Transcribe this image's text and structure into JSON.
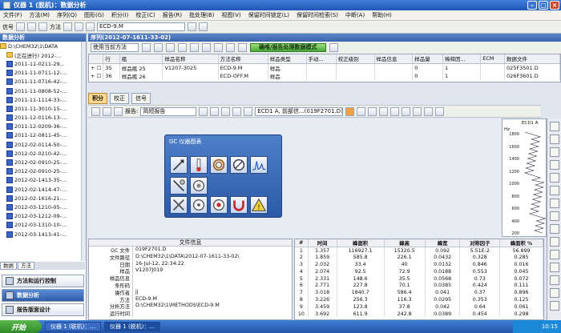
{
  "window": {
    "title": "仪器 1 (脱机)：数据分析"
  },
  "menu": {
    "items": [
      "文件(F)",
      "方法(M)",
      "序列(Q)",
      "图形(G)",
      "积分(I)",
      "校正(C)",
      "报告(R)",
      "批处理(B)",
      "视图(V)",
      "保留时间锁定(L)",
      "保留时间检索(S)",
      "中断(A)",
      "帮助(H)"
    ]
  },
  "toolbar": {
    "signal_label": "信号",
    "method_label": "方法",
    "method_value": "ECD-9.M"
  },
  "left_panel": {
    "title": "数据分析",
    "root": "D:\\CHEM32\\1\\DATA",
    "items": [
      "(正在进行) 2012-...",
      "2011-11-0211-29...",
      "2011-11-0711-12-...",
      "2011-11-0716-42-...",
      "2011-11-0808-52-...",
      "2011-11-1114-33-...",
      "2011-11-3010-15-...",
      "2011-12-0116-13-...",
      "2011-12-0209-36-...",
      "2011-12-0811-45-...",
      "2012-02-0114-50-...",
      "2012-02-0210-42-...",
      "2012-02-0910-25-...",
      "2012-02-0910-25-...",
      "2012-02-1413-35-...",
      "2012-02-1414-47-...",
      "2012-02-1616-21-...",
      "2012-03-1210-05-...",
      "2012-03-1212-09-...",
      "2012-03-1310-10-...",
      "2012-03-1413-41-..."
    ],
    "tabs": [
      "数据",
      "方法"
    ],
    "nav": [
      "方法和运行控制",
      "数据分析",
      "报告版面设计"
    ]
  },
  "sequence": {
    "title": "序列(2012-07-1611-33-02)",
    "method_select": "使用当前方法",
    "status_button": "确唯/报告处理数据模式",
    "columns": [
      "行",
      "瓶",
      "样品名称",
      "方法名称",
      "样品类型",
      "手动...",
      "校正级别",
      "样品信息",
      "样品量",
      "稀释因...",
      "ECM",
      "数据文件"
    ],
    "rows": [
      [
        "35",
        "样品瓶 25",
        "V1207-3025",
        "ECD-9.M",
        "样品",
        "",
        "",
        "",
        "0",
        "1",
        "",
        "025F3501.D"
      ],
      [
        "36",
        "样品瓶 26",
        "",
        "ECD-OFF.M",
        "样品",
        "",
        "",
        "",
        "0",
        "1",
        "",
        "026F3601.D"
      ]
    ]
  },
  "analysis": {
    "tabs": [
      "积分",
      "校正",
      "信号"
    ],
    "report_label": "报告:",
    "report_value": "简短报告",
    "signal_select": "ECD1 A, 前部信...(019F2701.D)"
  },
  "palette": {
    "title": "GC 仪器图表"
  },
  "minichart": {
    "title": "ECD1 A",
    "unit": "Hz",
    "ticks": [
      "1800",
      "1600",
      "1400",
      "1200",
      "1000",
      "800",
      "600",
      "400",
      "200"
    ]
  },
  "file_info": {
    "title": "文件信息",
    "rows": [
      [
        "GC 文件",
        "019F2701.D"
      ],
      [
        "文件路径",
        "D:\\CHEM32\\1\\DATA\\2012-07-1611-33-02\\"
      ],
      [
        "日期",
        "16-Jul-12, 22:34:22"
      ],
      [
        "样品",
        "V1207J019"
      ],
      [
        "样品信息",
        ""
      ],
      [
        "条形码",
        ""
      ],
      [
        "操作者",
        "jj"
      ],
      [
        "方法",
        "ECD-9.M"
      ],
      [
        "分析方法",
        "D:\\CHEM32\\1\\METHODS\\ECD-9.M"
      ],
      [
        "运行时间",
        ""
      ]
    ]
  },
  "peaks": {
    "columns": [
      "#",
      "时间",
      "峰面积",
      "峰高",
      "峰宽",
      "对称因子",
      "峰面积 %"
    ],
    "rows": [
      [
        "1",
        "1.357",
        "116927.1",
        "15320.5",
        "0.092",
        "5.51E-2",
        "56.899"
      ],
      [
        "2",
        "1.859",
        "585.8",
        "226.1",
        "0.0432",
        "0.328",
        "0.285"
      ],
      [
        "3",
        "2.032",
        "33.4",
        "40",
        "0.0132",
        "0.846",
        "0.016"
      ],
      [
        "4",
        "2.074",
        "92.5",
        "72.9",
        "0.0188",
        "0.553",
        "0.045"
      ],
      [
        "5",
        "2.331",
        "148.6",
        "35.5",
        "0.0568",
        "0.73",
        "0.072"
      ],
      [
        "6",
        "2.771",
        "227.8",
        "70.1",
        "0.0385",
        "0.424",
        "0.111"
      ],
      [
        "7",
        "3.018",
        "1840.7",
        "586.4",
        "0.041",
        "0.37",
        "0.896"
      ],
      [
        "8",
        "3.226",
        "256.3",
        "116.3",
        "0.0295",
        "0.353",
        "0.125"
      ],
      [
        "9",
        "3.459",
        "123.8",
        "37.8",
        "0.042",
        "0.64",
        "0.061"
      ],
      [
        "10",
        "3.692",
        "611.9",
        "242.8",
        "0.0389",
        "0.454",
        "0.298"
      ]
    ]
  },
  "taskbar": {
    "start": "开始",
    "tasks": [
      "仪器 1 (联机)：...",
      "仪器 1 (脱机)：..."
    ],
    "clock": "10:15"
  }
}
